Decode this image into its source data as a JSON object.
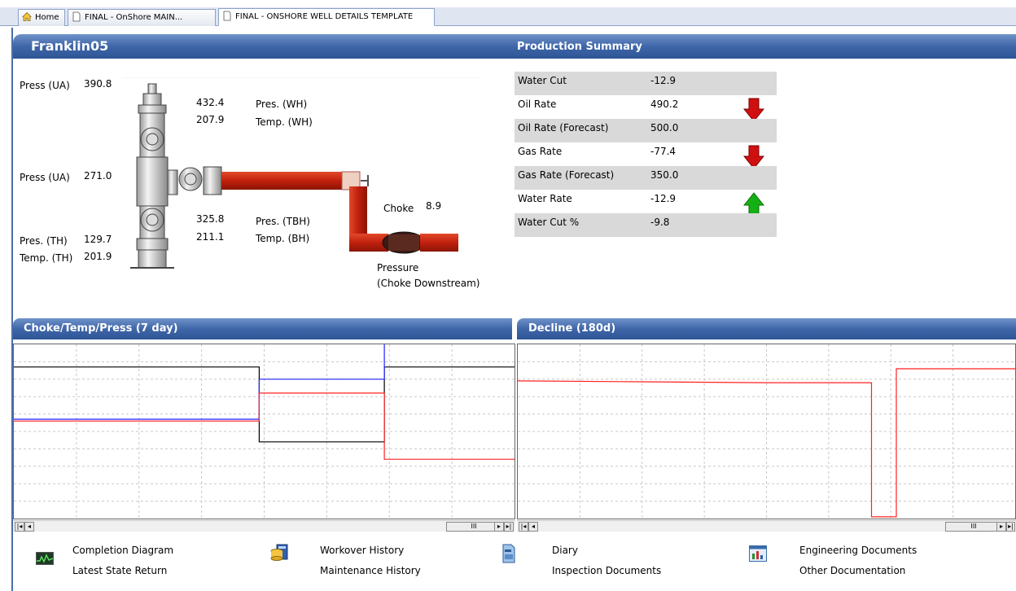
{
  "tabs": [
    {
      "label": "Home",
      "icon": "home-icon"
    },
    {
      "label": "FINAL - OnShore MAIN...",
      "icon": "document-icon"
    },
    {
      "label": "FINAL - ONSHORE WELL DETAILS TEMPLATE",
      "icon": "document-icon"
    }
  ],
  "well": {
    "title": "Franklin05",
    "readouts": [
      {
        "label": "Press (UA)",
        "value": "390.8"
      },
      {
        "label": "Press (UA)",
        "value": "271.0"
      },
      {
        "label": "Pres. (TH)",
        "value": "129.7"
      },
      {
        "label": "Temp. (TH)",
        "value": "201.9"
      },
      {
        "label": "Pres. (WH)",
        "value": "432.4"
      },
      {
        "label": "Temp. (WH)",
        "value": "207.9"
      },
      {
        "label": "Pres. (TBH)",
        "value": "325.8"
      },
      {
        "label": "Temp. (BH)",
        "value": "211.1"
      },
      {
        "label": "Choke",
        "value": "8.9"
      }
    ],
    "pressure_label_1": "Pressure",
    "pressure_label_2": "(Choke Downstream)"
  },
  "production_summary": {
    "title": "Production Summary",
    "rows": [
      {
        "name": "Water Cut",
        "value": "-12.9",
        "arrow": ""
      },
      {
        "name": "Oil Rate",
        "value": "490.2",
        "arrow": "down"
      },
      {
        "name": "Oil Rate (Forecast)",
        "value": "500.0",
        "arrow": ""
      },
      {
        "name": "Gas Rate",
        "value": "-77.4",
        "arrow": "down"
      },
      {
        "name": "Gas Rate (Forecast)",
        "value": "350.0",
        "arrow": ""
      },
      {
        "name": "Water Rate",
        "value": "-12.9",
        "arrow": "up"
      },
      {
        "name": "Water Cut %",
        "value": "-9.8",
        "arrow": ""
      }
    ]
  },
  "panels": {
    "choke_title": "Choke/Temp/Press (7 day)",
    "decline_title": "Decline (180d)"
  },
  "scrollbar": {
    "thumb_glyph": "III"
  },
  "footer": {
    "groups": [
      {
        "icon": "completion-diagram-icon",
        "links": [
          "Completion Diagram",
          "Latest State Return"
        ]
      },
      {
        "icon": "workover-history-icon",
        "links": [
          "Workover History",
          "Maintenance History"
        ]
      },
      {
        "icon": "diary-icon",
        "links": [
          "Diary",
          "Inspection Documents"
        ]
      },
      {
        "icon": "engineering-documents-icon",
        "links": [
          "Engineering Documents",
          "Other Documentation"
        ]
      }
    ]
  },
  "colors": {
    "header_blue": "#3f66a8",
    "pipe_red": "#c0200d",
    "arrow_down": "#d01010",
    "arrow_up": "#14b014",
    "series_black": "#000000",
    "series_blue": "#2020ff",
    "series_red": "#ff2020"
  },
  "chart_data": [
    {
      "type": "line",
      "title": "Choke/Temp/Press (7 day)",
      "grid": true,
      "ylim": [
        0,
        10
      ],
      "xlim": [
        0,
        10
      ],
      "series": [
        {
          "color": "#000000",
          "x": [
            0,
            4.9,
            4.9,
            7.4,
            7.4,
            10
          ],
          "y": [
            8.7,
            8.7,
            4.4,
            4.4,
            8.7,
            8.7
          ]
        },
        {
          "color": "#2020ff",
          "x": [
            0,
            4.9,
            4.9,
            7.4,
            7.4,
            7.4,
            7.4
          ],
          "y": [
            5.7,
            5.7,
            8.0,
            8.0,
            13.0,
            13.0,
            8.0
          ]
        },
        {
          "color": "#ff2020",
          "x": [
            0,
            4.9,
            4.9,
            7.4,
            7.4,
            10
          ],
          "y": [
            5.6,
            5.6,
            7.2,
            7.2,
            3.4,
            3.4
          ]
        }
      ]
    },
    {
      "type": "line",
      "title": "Decline (180d)",
      "grid": true,
      "ylim": [
        0,
        10
      ],
      "xlim": [
        0,
        180
      ],
      "series": [
        {
          "color": "#ff2020",
          "x": [
            0,
            45,
            90,
            128,
            128,
            137,
            137,
            160,
            180
          ],
          "y": [
            7.9,
            7.85,
            7.8,
            7.8,
            0.1,
            0.1,
            8.6,
            8.6,
            8.6
          ]
        }
      ]
    }
  ]
}
